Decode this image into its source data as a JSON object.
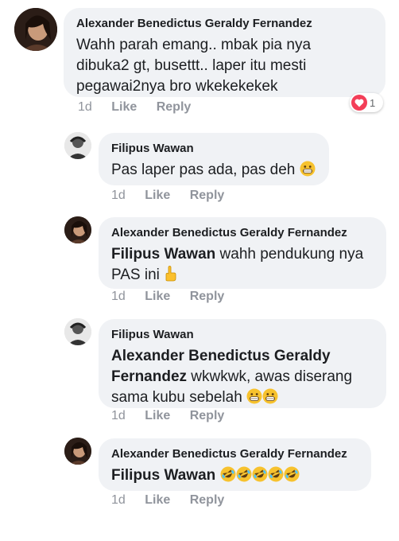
{
  "comments": [
    {
      "author": "Alexander Benedictus Geraldy Fernandez",
      "text": "Wahh parah emang.. mbak pia nya dibuka2 gt, busettt.. laper itu mesti pegawai2nya bro wkekekekek",
      "time": "1d",
      "like": "Like",
      "reply": "Reply",
      "reaction": {
        "icon": "heart-icon",
        "count": "1"
      }
    },
    {
      "author": "Filipus Wawan",
      "text": "Pas laper pas ada, pas deh",
      "emojis": [
        "grinning-face"
      ],
      "time": "1d",
      "like": "Like",
      "reply": "Reply"
    },
    {
      "author": "Alexander Benedictus Geraldy Fernandez",
      "mention": "Filipus Wawan",
      "text": " wahh pendukung nya PAS ini",
      "emojis": [
        "pointing-hand"
      ],
      "time": "1d",
      "like": "Like",
      "reply": "Reply"
    },
    {
      "author": "Filipus Wawan",
      "mention": "Alexander Benedictus Geraldy Fernandez",
      "text": " wkwkwk, awas diserang sama kubu sebelah",
      "emojis": [
        "grinning-face",
        "grinning-face"
      ],
      "time": "1d",
      "like": "Like",
      "reply": "Reply"
    },
    {
      "author": "Alexander Benedictus Geraldy Fernandez",
      "mention": "Filipus Wawan",
      "text": "",
      "emojis": [
        "rofl-face",
        "rofl-face",
        "rofl-face",
        "rofl-face",
        "rofl-face"
      ],
      "time": "1d",
      "like": "Like",
      "reply": "Reply"
    }
  ],
  "colors": {
    "bubble": "#f0f2f5",
    "meta": "#90949c",
    "heart": "#f33e58"
  }
}
